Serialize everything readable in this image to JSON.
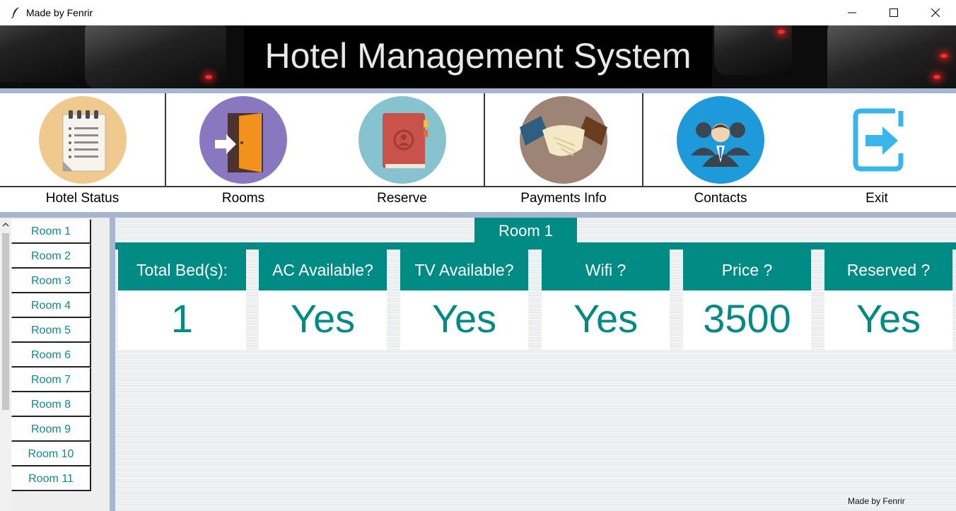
{
  "window": {
    "title": "Made by Fenrir",
    "icon": "feather-icon",
    "controls": [
      "minimize-icon",
      "maximize-icon",
      "close-icon"
    ]
  },
  "header": {
    "title": "Hotel Management System"
  },
  "toolbar": {
    "items": [
      {
        "label": "Hotel Status",
        "icon": "notepad-icon",
        "color": "#f0c98f"
      },
      {
        "label": "Rooms",
        "icon": "door-enter-icon",
        "color": "#8878c0"
      },
      {
        "label": "Reserve",
        "icon": "address-book-icon",
        "color": "#87c3cf"
      },
      {
        "label": "Payments Info",
        "icon": "handshake-icon",
        "color": "#9d8474"
      },
      {
        "label": "Contacts",
        "icon": "people-icon",
        "color": "#1e9ad8"
      },
      {
        "label": "Exit",
        "icon": "exit-icon",
        "color": "#3ab5ec"
      }
    ]
  },
  "sidebar": {
    "rooms": [
      "Room 1",
      "Room 2",
      "Room 3",
      "Room 4",
      "Room 5",
      "Room 6",
      "Room 7",
      "Room 8",
      "Room 9",
      "Room 10",
      "Room 11"
    ]
  },
  "details": {
    "room_title": "Room 1",
    "fields": [
      {
        "label": "Total Bed(s):",
        "value": "1"
      },
      {
        "label": "AC Available?",
        "value": "Yes"
      },
      {
        "label": "TV Available?",
        "value": "Yes"
      },
      {
        "label": "Wifi ?",
        "value": "Yes"
      },
      {
        "label": "Price ?",
        "value": "3500"
      },
      {
        "label": "Reserved ?",
        "value": "Yes"
      }
    ]
  },
  "footer": {
    "credit": "Made by Fenrir"
  },
  "colors": {
    "accent": "#008a84",
    "separator": "#a7b6cf"
  }
}
